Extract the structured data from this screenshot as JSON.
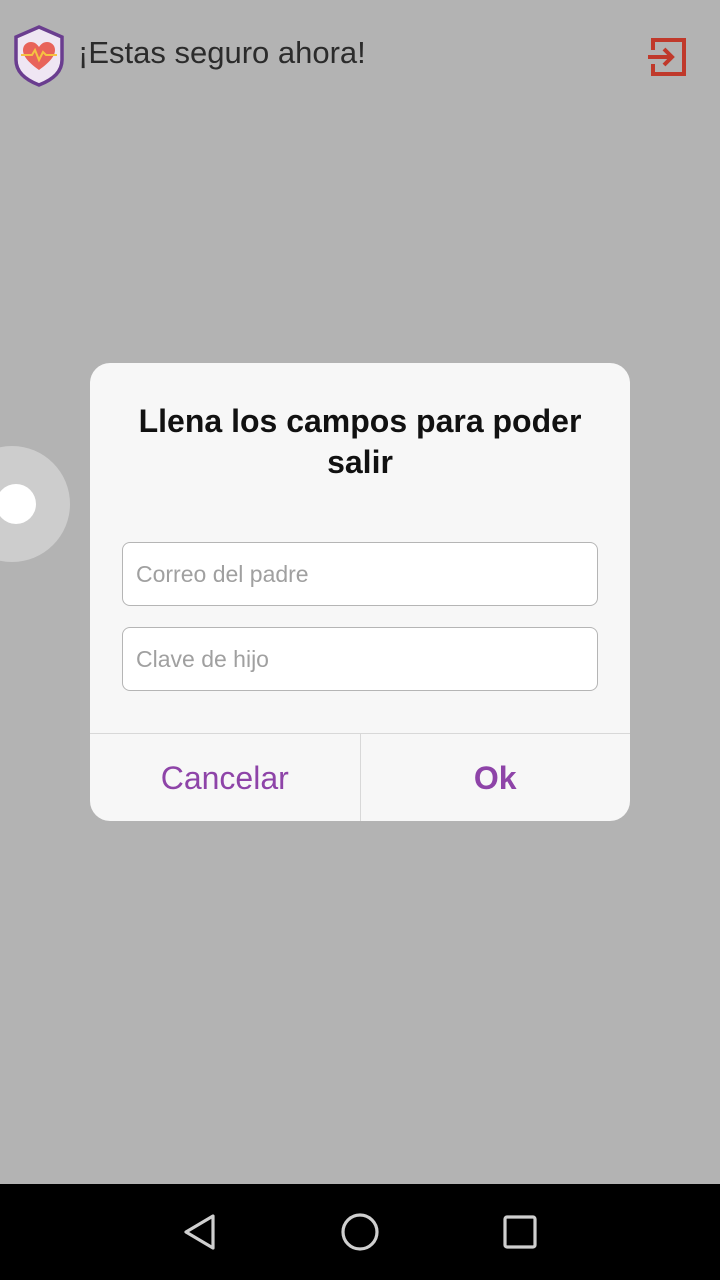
{
  "app_bar": {
    "title": "¡Estas seguro ahora!",
    "logo_icon": "shield-heart-icon",
    "exit_icon": "exit-icon",
    "colors": {
      "logo_shield": "#6a3d8f",
      "logo_heart": "#e8635a",
      "exit": "#c0392b"
    }
  },
  "dialog": {
    "title": "Llena los campos para poder salir",
    "email_placeholder": "Correo del padre",
    "key_placeholder": "Clave de hijo",
    "cancel_label": "Cancelar",
    "ok_label": "Ok",
    "accent_color": "#8e44a8"
  },
  "nav_bar": {
    "back_icon": "back-triangle-icon",
    "home_icon": "home-circle-icon",
    "recents_icon": "recents-square-icon"
  }
}
